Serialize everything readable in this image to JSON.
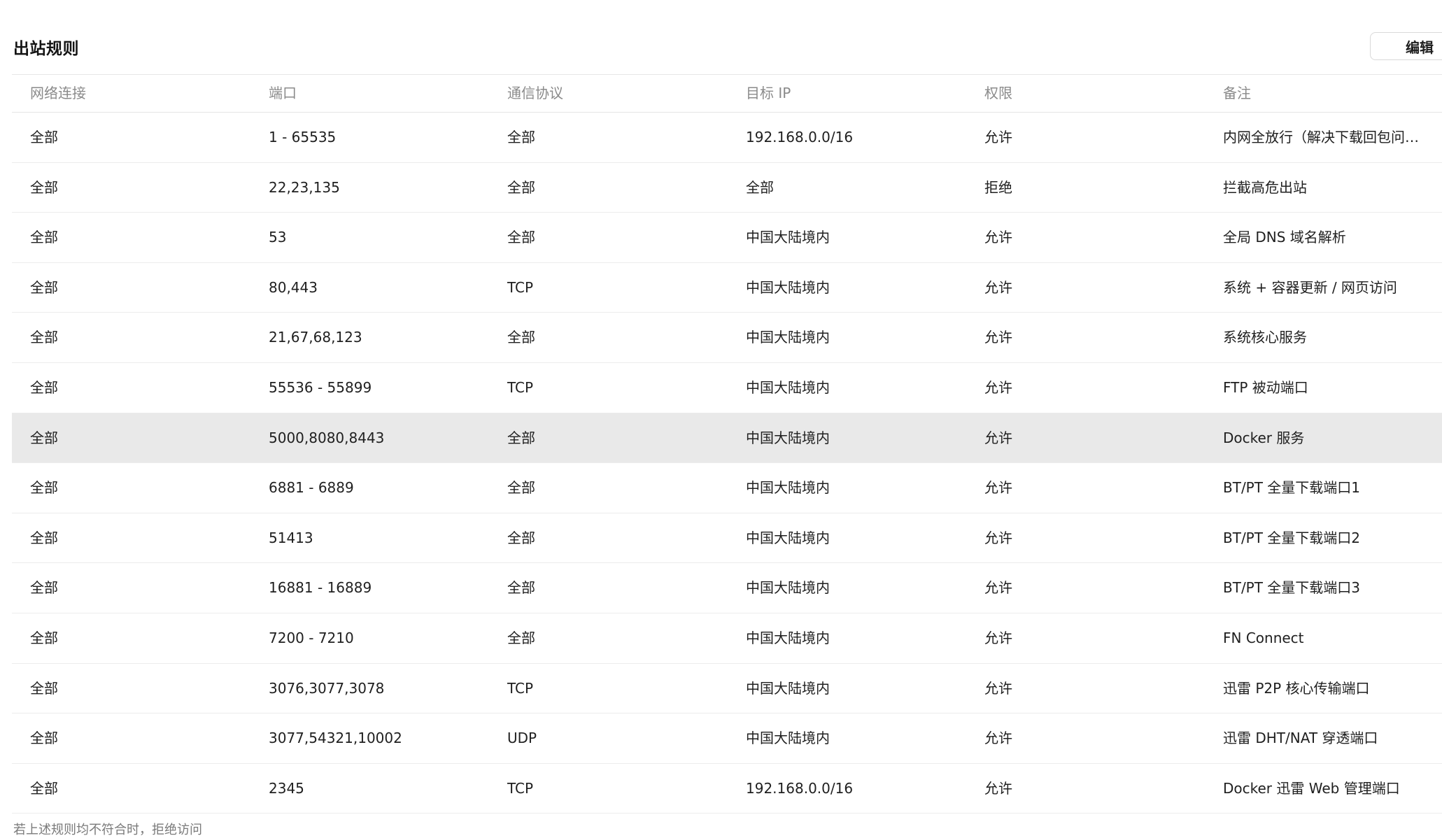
{
  "header": {
    "title": "出站规则",
    "edit_label": "编辑"
  },
  "table": {
    "columns": [
      "网络连接",
      "端口",
      "通信协议",
      "目标 IP",
      "权限",
      "备注"
    ],
    "rows": [
      {
        "network": "全部",
        "port": "1 - 65535",
        "protocol": "全部",
        "target_ip": "192.168.0.0/16",
        "permission": "允许",
        "note": "内网全放行（解决下载回包问题）"
      },
      {
        "network": "全部",
        "port": "22,23,135",
        "protocol": "全部",
        "target_ip": "全部",
        "permission": "拒绝",
        "note": "拦截高危出站"
      },
      {
        "network": "全部",
        "port": "53",
        "protocol": "全部",
        "target_ip": "中国大陆境内",
        "permission": "允许",
        "note": "全局 DNS 域名解析"
      },
      {
        "network": "全部",
        "port": "80,443",
        "protocol": "TCP",
        "target_ip": "中国大陆境内",
        "permission": "允许",
        "note": "系统 + 容器更新 / 网页访问"
      },
      {
        "network": "全部",
        "port": "21,67,68,123",
        "protocol": "全部",
        "target_ip": "中国大陆境内",
        "permission": "允许",
        "note": "系统核心服务"
      },
      {
        "network": "全部",
        "port": "55536 - 55899",
        "protocol": "TCP",
        "target_ip": "中国大陆境内",
        "permission": "允许",
        "note": "FTP 被动端口"
      },
      {
        "network": "全部",
        "port": "5000,8080,8443",
        "protocol": "全部",
        "target_ip": "中国大陆境内",
        "permission": "允许",
        "note": "Docker 服务"
      },
      {
        "network": "全部",
        "port": "6881 - 6889",
        "protocol": "全部",
        "target_ip": "中国大陆境内",
        "permission": "允许",
        "note": "BT/PT 全量下载端口1"
      },
      {
        "network": "全部",
        "port": "51413",
        "protocol": "全部",
        "target_ip": "中国大陆境内",
        "permission": "允许",
        "note": "BT/PT 全量下载端口2"
      },
      {
        "network": "全部",
        "port": "16881 - 16889",
        "protocol": "全部",
        "target_ip": "中国大陆境内",
        "permission": "允许",
        "note": "BT/PT 全量下载端口3"
      },
      {
        "network": "全部",
        "port": "7200 - 7210",
        "protocol": "全部",
        "target_ip": "中国大陆境内",
        "permission": "允许",
        "note": "FN Connect"
      },
      {
        "network": "全部",
        "port": "3076,3077,3078",
        "protocol": "TCP",
        "target_ip": "中国大陆境内",
        "permission": "允许",
        "note": "迅雷 P2P 核心传输端口"
      },
      {
        "network": "全部",
        "port": "3077,54321,10002",
        "protocol": "UDP",
        "target_ip": "中国大陆境内",
        "permission": "允许",
        "note": "迅雷 DHT/NAT 穿透端口"
      },
      {
        "network": "全部",
        "port": "2345",
        "protocol": "TCP",
        "target_ip": "192.168.0.0/16",
        "permission": "允许",
        "note": "Docker 迅雷 Web 管理端口"
      }
    ]
  },
  "footer": {
    "note": "若上述规则均不符合时，拒绝访问"
  }
}
